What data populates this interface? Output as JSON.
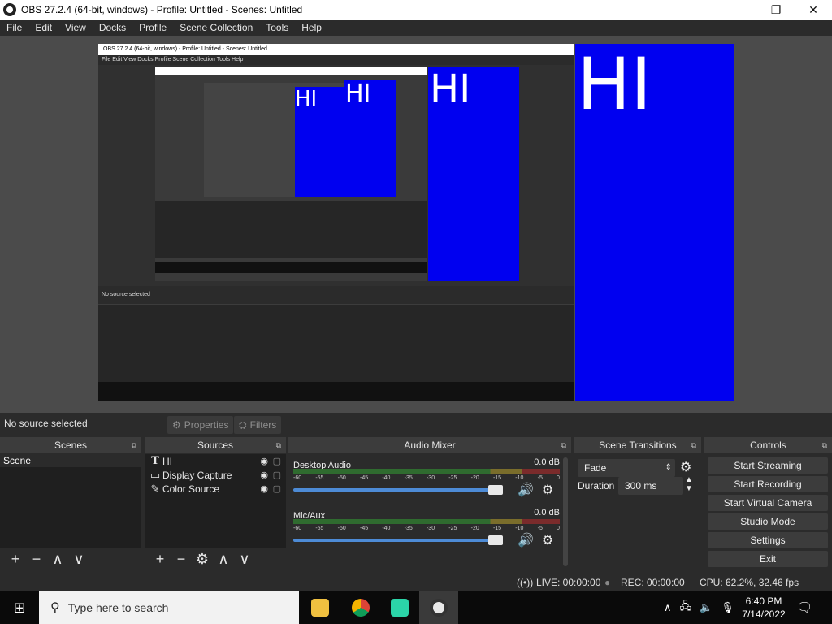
{
  "window": {
    "title": "OBS 27.2.4 (64-bit, windows) - Profile: Untitled - Scenes: Untitled",
    "minimize": "—",
    "maximize": "❐",
    "close": "✕"
  },
  "menu": [
    "File",
    "Edit",
    "View",
    "Docks",
    "Profile",
    "Scene Collection",
    "Tools",
    "Help"
  ],
  "preview": {
    "source_text": "HI",
    "color": "#0000f0",
    "nested_title": "OBS 27.2.4 (64-bit, windows) - Profile: Untitled - Scenes: Untitled",
    "nested_menu": "File   Edit   View   Docks   Profile   Scene Collection   Tools   Help"
  },
  "selection": {
    "label": "No source selected",
    "properties": "Properties",
    "filters": "Filters"
  },
  "scenes": {
    "title": "Scenes",
    "items": [
      "Scene"
    ]
  },
  "sources": {
    "title": "Sources",
    "items": [
      {
        "icon": "text-icon",
        "label": "HI"
      },
      {
        "icon": "monitor-icon",
        "label": "Display Capture"
      },
      {
        "icon": "brush-icon",
        "label": "Color Source"
      }
    ]
  },
  "mixer": {
    "title": "Audio Mixer",
    "ticks": [
      "-60",
      "-55",
      "-50",
      "-45",
      "-40",
      "-35",
      "-30",
      "-25",
      "-20",
      "-15",
      "-10",
      "-5",
      "0"
    ],
    "channels": [
      {
        "name": "Desktop Audio",
        "db": "0.0 dB",
        "level": 0.97
      },
      {
        "name": "Mic/Aux",
        "db": "0.0 dB",
        "level": 0.97
      }
    ]
  },
  "transitions": {
    "title": "Scene Transitions",
    "type": "Fade",
    "duration_label": "Duration",
    "duration": "300 ms"
  },
  "controls": {
    "title": "Controls",
    "buttons": [
      "Start Streaming",
      "Start Recording",
      "Start Virtual Camera",
      "Studio Mode",
      "Settings",
      "Exit"
    ]
  },
  "status": {
    "live": "LIVE: 00:00:00",
    "rec": "REC: 00:00:00",
    "cpu": "CPU: 62.2%, 32.46 fps"
  },
  "taskbar": {
    "search_placeholder": "Type here to search",
    "time": "6:40 PM",
    "date": "7/14/2022"
  },
  "colors": {
    "accent": "#4d8bd6",
    "panel": "#2b2b2b",
    "list": "#1f1f1f"
  }
}
